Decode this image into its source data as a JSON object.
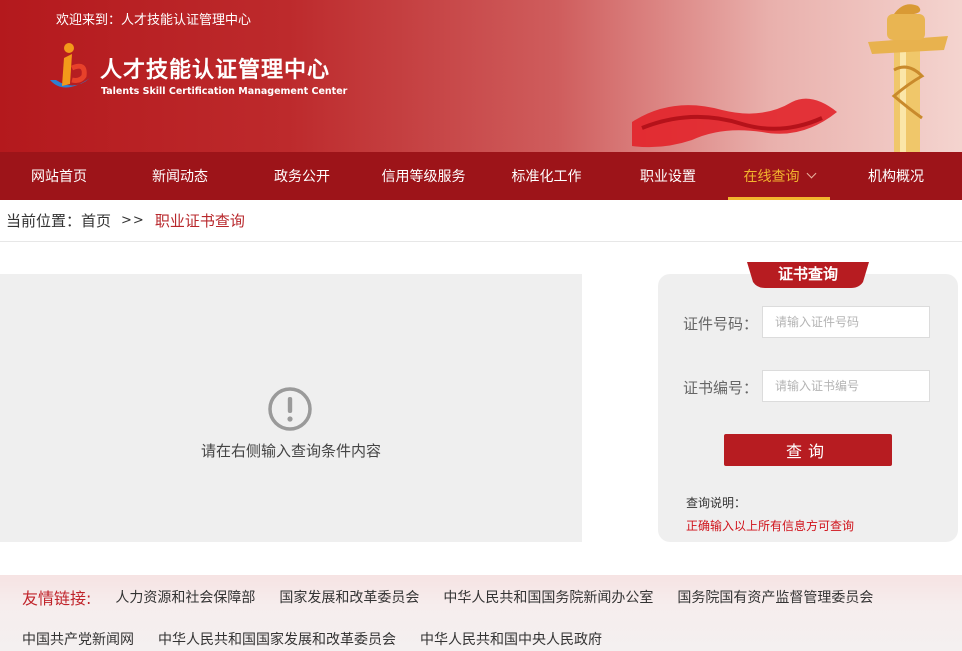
{
  "header": {
    "welcome": "欢迎来到：人才技能认证管理中心",
    "logo_cn": "人才技能认证管理中心",
    "logo_en": "Talents Skill Certification Management Center"
  },
  "nav": {
    "items": [
      {
        "label": "网站首页"
      },
      {
        "label": "新闻动态"
      },
      {
        "label": "政务公开"
      },
      {
        "label": "信用等级服务"
      },
      {
        "label": "标准化工作"
      },
      {
        "label": "职业设置"
      },
      {
        "label": "在线查询",
        "active": true
      },
      {
        "label": "机构概况"
      }
    ]
  },
  "breadcrumb": {
    "prefix": "当前位置：",
    "home": "首页",
    "separator": ">>",
    "current": "职业证书查询"
  },
  "result": {
    "message": "请在右侧输入查询条件内容",
    "icon": "exclamation-circle-icon"
  },
  "query": {
    "tab_title": "证书查询",
    "id_label": "证件号码：",
    "id_placeholder": "请输入证件号码",
    "cert_label": "证书编号：",
    "cert_placeholder": "请输入证书编号",
    "submit_label": "查询",
    "note_title": "查询说明：",
    "note_text": "正确输入以上所有信息方可查询"
  },
  "links": {
    "title": "友情链接:",
    "row1": [
      "人力资源和社会保障部",
      "国家发展和改革委员会",
      "中华人民共和国国务院新闻办公室",
      "国务院国有资产监督管理委员会"
    ],
    "row2": [
      "中国共产党新闻网",
      "中华人民共和国国家发展和改革委员会",
      "中华人民共和国中央人民政府"
    ]
  },
  "colors": {
    "brand_red": "#9d1419",
    "button_red": "#b71c21",
    "nav_active": "#f2b52e",
    "note_red": "#d0121a"
  }
}
